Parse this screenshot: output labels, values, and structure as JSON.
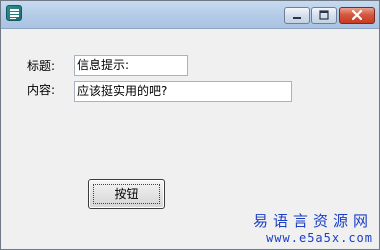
{
  "window": {
    "title": "",
    "icon": "app-icon",
    "controls": {
      "minimize": "minimize-icon",
      "maximize": "maximize-icon",
      "close": "close-icon"
    }
  },
  "form": {
    "title_label": "标题:",
    "title_value": "信息提示:",
    "content_label": "内容:",
    "content_value": "应该挺实用的吧?",
    "button_label": "按钮"
  },
  "watermark": {
    "name": "易语言资源网",
    "url": "www.e5a5x.com"
  },
  "colors": {
    "titlebar": "#b6cde8",
    "window_bg": "#f0f0f0",
    "close_button": "#c73a22",
    "watermark": "#1b3fc4"
  }
}
